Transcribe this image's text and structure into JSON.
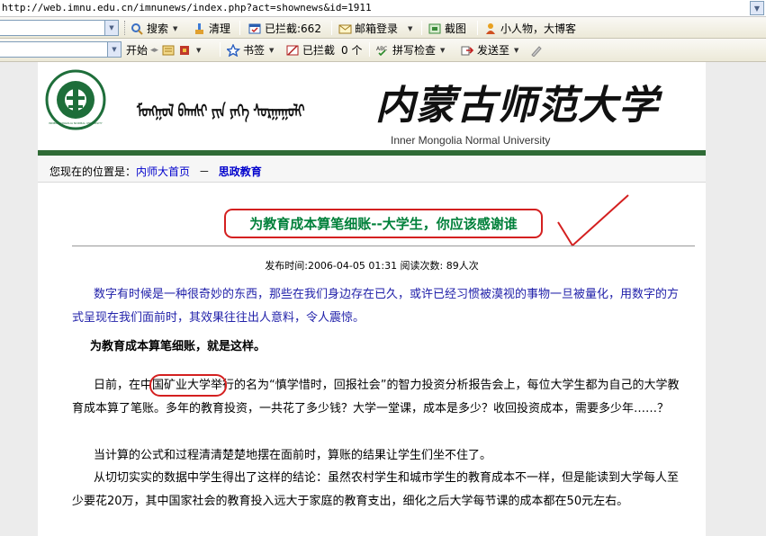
{
  "browser": {
    "address": "http://web.imnu.edu.cn/imnunews/index.php?act=shownews&id=1911"
  },
  "toolbar1": {
    "search_label": "搜索",
    "clear_label": "清理",
    "blocked_label": "已拦截:662",
    "mail_label": "邮箱登录",
    "screenshot_label": "截图",
    "blog_label": "小人物，大博客"
  },
  "toolbar2": {
    "start_label": "开始",
    "bookmarks_label": "书签",
    "blocked_label": "已拦截",
    "blocked_count": "0 个",
    "spellcheck_label": "拼写检查",
    "sendto_label": "发送至"
  },
  "header": {
    "emblem_text": "INNER MONGOLIA NORMAL UNIVERSITY",
    "mongolian_text": "ᠮᠣᠩᠭᠣᠯ ᠪᠠᠭᠰᠢ ᠶᠢᠨ ᠶᠡᠬᠡ ᠰᠤᠷᠭᠠᠭᠤᠯᠢ",
    "chinese_name": "内蒙古师范大学",
    "english_name": "Inner Mongolia Normal University"
  },
  "breadcrumb": {
    "prefix": "您现在的位置是：",
    "home": "内师大首页",
    "separator": "－",
    "section": "思政教育"
  },
  "article": {
    "title": "为教育成本算笔细账--大学生，你应该感谢谁",
    "meta": "发布时间:2006-04-05 01:31 阅读次数: 89人次",
    "intro": "数字有时候是一种很奇妙的东西，那些在我们身边存在已久，或许已经习惯被漠视的事物一旦被量化，用数字的方式呈现在我们面前时，其效果往往出人意料，令人震惊。",
    "subheading": "为教育成本算笔细账，就是这样。",
    "p2": "日前，在中国矿业大学举行的名为“慎学惜时，回报社会”的智力投资分析报告会上，每位大学生都为自己的大学教育成本算了笔账。多年的教育投资，一共花了多少钱？大学一堂课，成本是多少？收回投资成本，需要多少年……？",
    "p3": "当计算的公式和过程清清楚楚地摆在面前时，算账的结果让学生们坐不住了。",
    "p4": "从切切实实的数据中学生得出了这样的结论：虽然农村学生和城市学生的教育成本不一样，但是能读到大学每人至少要花20万，其中国家社会的教育投入远大于家庭的教育支出，细化之后大学每节课的成本都在50元左右。"
  },
  "colors": {
    "title_green": "#00803a",
    "annotation_red": "#d42020",
    "link_blue": "#0000cc",
    "banner_green": "#2f6b36"
  }
}
